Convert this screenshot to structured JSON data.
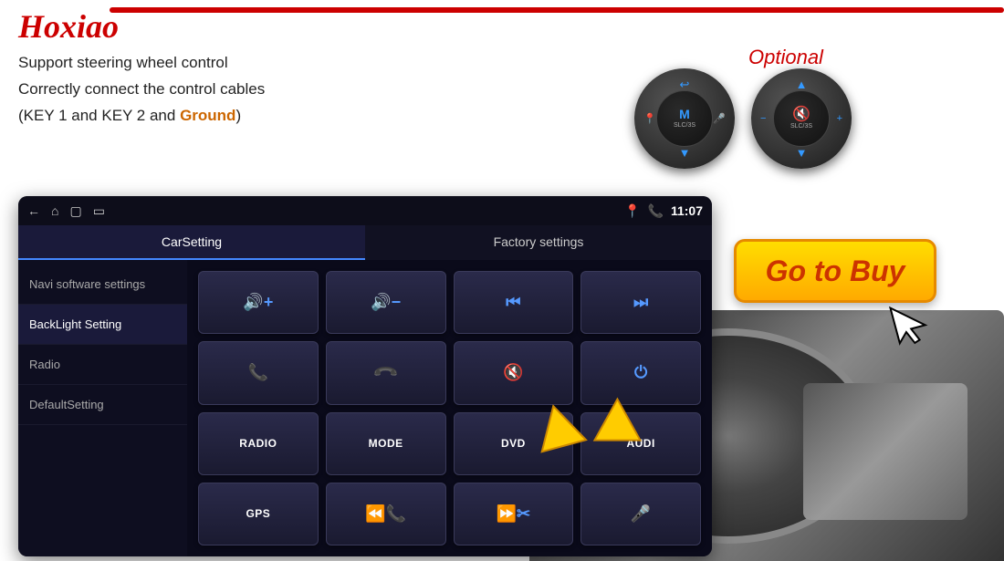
{
  "brand": "Hoxiao",
  "header": {
    "line1": "Support steering wheel control",
    "line2": "Correctly connect the control cables",
    "line3_prefix": "(KEY 1 and KEY 2 and ",
    "line3_highlight": "Ground",
    "line3_suffix": ")"
  },
  "optional": {
    "label": "Optional"
  },
  "go_buy": {
    "label": "Go to Buy"
  },
  "screen": {
    "status": {
      "time": "11:07"
    },
    "tabs": [
      {
        "label": "CarSetting",
        "active": true
      },
      {
        "label": "Factory settings",
        "active": false
      }
    ],
    "menu_items": [
      {
        "label": "Navi software settings",
        "active": false
      },
      {
        "label": "BackLight Setting",
        "active": true
      },
      {
        "label": "Radio",
        "active": false
      },
      {
        "label": "DefaultSetting",
        "active": false
      }
    ],
    "controls": [
      {
        "type": "icon",
        "symbol": "🔊+"
      },
      {
        "type": "icon",
        "symbol": "🔊-"
      },
      {
        "type": "icon",
        "symbol": "⏮"
      },
      {
        "type": "icon",
        "symbol": "⏭"
      },
      {
        "type": "icon",
        "symbol": "📞"
      },
      {
        "type": "icon",
        "symbol": "📵"
      },
      {
        "type": "icon",
        "symbol": "🔇"
      },
      {
        "type": "icon",
        "symbol": "⏻"
      },
      {
        "type": "text",
        "symbol": "RADIO"
      },
      {
        "type": "text",
        "symbol": "MODE"
      },
      {
        "type": "text",
        "symbol": "DVD"
      },
      {
        "type": "text",
        "symbol": "AUDI"
      },
      {
        "type": "text",
        "symbol": "GPS"
      },
      {
        "type": "icon",
        "symbol": "⏭📞"
      },
      {
        "type": "icon",
        "symbol": "⏭✂"
      },
      {
        "type": "icon",
        "symbol": "🎤"
      }
    ]
  },
  "icons": {
    "back": "←",
    "home": "⌂",
    "recent": "▢",
    "location": "📍",
    "phone": "📞",
    "chevron_up": "▲",
    "chevron_down": "▼",
    "minus": "−",
    "plus": "+",
    "arrow_cursor": "↖"
  }
}
